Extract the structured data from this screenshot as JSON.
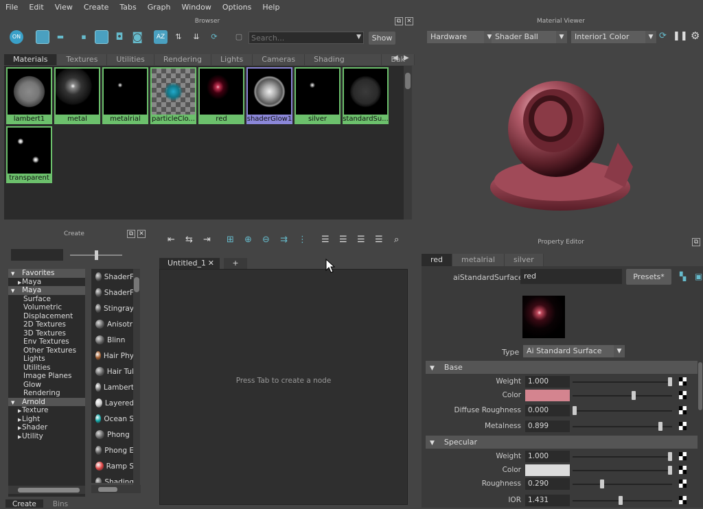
{
  "menu": [
    "File",
    "Edit",
    "View",
    "Create",
    "Tabs",
    "Graph",
    "Window",
    "Options",
    "Help"
  ],
  "browser": {
    "title": "Browser",
    "search_placeholder": "Search...",
    "show_label": "Show",
    "tabs": [
      "Materials",
      "Textures",
      "Utilities",
      "Rendering",
      "Lights",
      "Cameras",
      "Shading Groups",
      "Bak"
    ],
    "swatches": [
      "lambert1",
      "metal",
      "metalrial",
      "particleClo...",
      "red",
      "shaderGlow1",
      "silver",
      "standardSu...",
      "transparent"
    ]
  },
  "viewer": {
    "title": "Material Viewer",
    "renderer": "Hardware",
    "geometry": "Shader Ball",
    "environment": "Interior1 Color"
  },
  "create": {
    "title": "Create",
    "tree": [
      {
        "label": "Favorites",
        "type": "group"
      },
      {
        "label": "Maya",
        "type": "sub"
      },
      {
        "label": "Maya",
        "type": "group"
      },
      {
        "label": "Surface",
        "type": "item"
      },
      {
        "label": "Volumetric",
        "type": "item"
      },
      {
        "label": "Displacement",
        "type": "item"
      },
      {
        "label": "2D Textures",
        "type": "item"
      },
      {
        "label": "3D Textures",
        "type": "item"
      },
      {
        "label": "Env Textures",
        "type": "item"
      },
      {
        "label": "Other Textures",
        "type": "item"
      },
      {
        "label": "Lights",
        "type": "item"
      },
      {
        "label": "Utilities",
        "type": "item"
      },
      {
        "label": "Image Planes",
        "type": "item"
      },
      {
        "label": "Glow",
        "type": "item"
      },
      {
        "label": "Rendering",
        "type": "item"
      },
      {
        "label": "Arnold",
        "type": "group"
      },
      {
        "label": "Texture",
        "type": "sub"
      },
      {
        "label": "Light",
        "type": "sub"
      },
      {
        "label": "Shader",
        "type": "sub"
      },
      {
        "label": "Utility",
        "type": "sub"
      }
    ],
    "nodes": [
      "ShaderF",
      "ShaderF",
      "Stingray",
      "Anisotr",
      "Blinn",
      "Hair Phy",
      "Hair Tul",
      "Lambert",
      "Layered",
      "Ocean S",
      "Phong",
      "Phong E",
      "Ramp S",
      "Shading"
    ],
    "bottom_tabs": [
      "Create",
      "Bins"
    ]
  },
  "editor": {
    "tab": "Untitled_1",
    "add_tab": "+",
    "hint": "Press Tab to create a node"
  },
  "property": {
    "title": "Property Editor",
    "tabs": [
      "red",
      "metalrial",
      "silver"
    ],
    "shader_type_label": "aiStandardSurface:",
    "shader_name": "red",
    "presets": "Presets*",
    "type_label": "Type",
    "type_value": "Ai Standard Surface",
    "base_section": "Base",
    "specular_section": "Specular",
    "base": [
      {
        "label": "Weight",
        "value": "1.000",
        "level": 1.0
      },
      {
        "label": "Color",
        "value": "",
        "color": "#d4848f",
        "level": 0.62
      },
      {
        "label": "Diffuse Roughness",
        "value": "0.000",
        "level": 0.0
      },
      {
        "label": "Metalness",
        "value": "0.899",
        "level": 0.9
      }
    ],
    "specular": [
      {
        "label": "Weight",
        "value": "1.000",
        "level": 1.0
      },
      {
        "label": "Color",
        "value": "",
        "color": "#dcdcdc",
        "level": 1.0
      },
      {
        "label": "Roughness",
        "value": "0.290",
        "level": 0.29
      },
      {
        "label": "IOR",
        "value": "1.431",
        "level": 0.48
      }
    ]
  }
}
